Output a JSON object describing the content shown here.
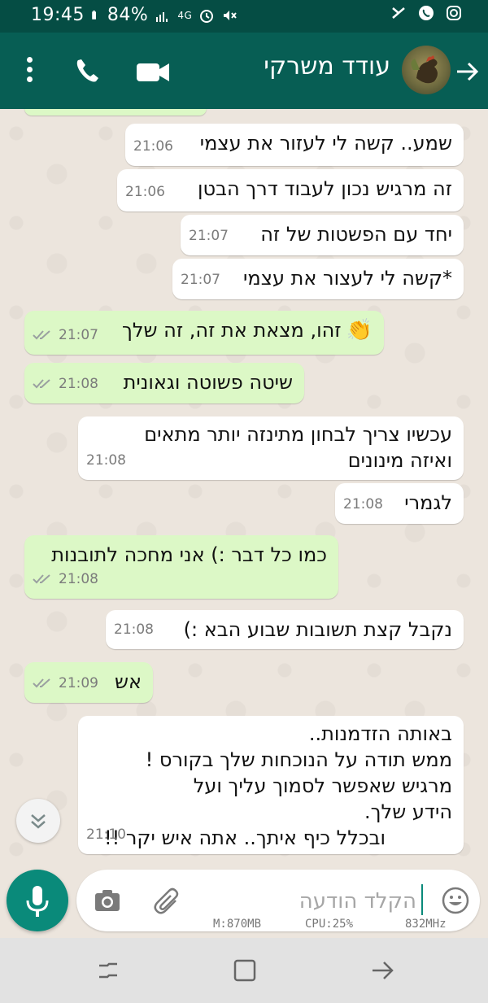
{
  "status_bar": {
    "time": "19:45",
    "battery": "84%",
    "network": "4G"
  },
  "header": {
    "contact_name": "עודד משרקי"
  },
  "messages": [
    {
      "dir": "in",
      "lines": [
        "שמע.. קשה לי לעזור את עצמי"
      ],
      "time": "21:06"
    },
    {
      "dir": "in",
      "lines": [
        "זה מרגיש נכון לעבוד דרך הבטן"
      ],
      "time": "21:06"
    },
    {
      "dir": "in",
      "lines": [
        "יחד עם הפשטות של זה"
      ],
      "time": "21:07"
    },
    {
      "dir": "in",
      "lines": [
        "*קשה לי לעצור את עצמי"
      ],
      "time": "21:07"
    },
    {
      "dir": "out",
      "lines": [
        "זהו, מצאת את זה, זה שלך"
      ],
      "emoji": "👏",
      "time": "21:07"
    },
    {
      "dir": "out",
      "lines": [
        "שיטה פשוטה וגאונית"
      ],
      "time": "21:08"
    },
    {
      "dir": "in",
      "lines": [
        "עכשיו צריך לבחון מתינזה יותר מתאים",
        "ואיזה מינונים"
      ],
      "time": "21:08"
    },
    {
      "dir": "in",
      "lines": [
        "לגמרי"
      ],
      "time": "21:08"
    },
    {
      "dir": "out",
      "lines": [
        "כמו כל דבר :) אני מחכה לתובנות"
      ],
      "time": "21:08"
    },
    {
      "dir": "in",
      "lines": [
        "נקבל קצת תשובות שבוע הבא :)"
      ],
      "time": "21:08"
    },
    {
      "dir": "out",
      "lines": [
        "אש"
      ],
      "time": "21:09"
    },
    {
      "dir": "in",
      "lines": [
        "באותה הזדמנות..",
        "ממש תודה על הנוכחות שלך בקורס !",
        "מרגיש שאפשר לסמוך עליך ועל",
        "הידע שלך.",
        "ובכלל כיף איתך.. אתה איש יקר !!"
      ],
      "time": "21:10"
    }
  ],
  "input": {
    "placeholder": "הקלד הודעה"
  },
  "debug_overlay": {
    "mem": "M:870MB",
    "cpu": "CPU:25%",
    "freq": "832MHz"
  },
  "colors": {
    "header": "#075e54",
    "status_bar": "#054d44",
    "outgoing_bubble": "#dcf8c6",
    "incoming_bubble": "#ffffff",
    "accent": "#0a8a7a",
    "read_ticks": "#9aa0a0"
  },
  "icons": {
    "status": [
      "sim-icon",
      "signal-icon",
      "alarm-icon",
      "mute-icon",
      "nfc-icon",
      "whatsapp-icon",
      "instagram-icon"
    ],
    "header": [
      "menu-icon",
      "phone-icon",
      "video-icon",
      "back-arrow-icon"
    ],
    "input": [
      "mic-icon",
      "camera-icon",
      "attach-icon",
      "emoji-icon"
    ],
    "nav": [
      "recent-apps-icon",
      "home-icon",
      "back-icon"
    ]
  }
}
